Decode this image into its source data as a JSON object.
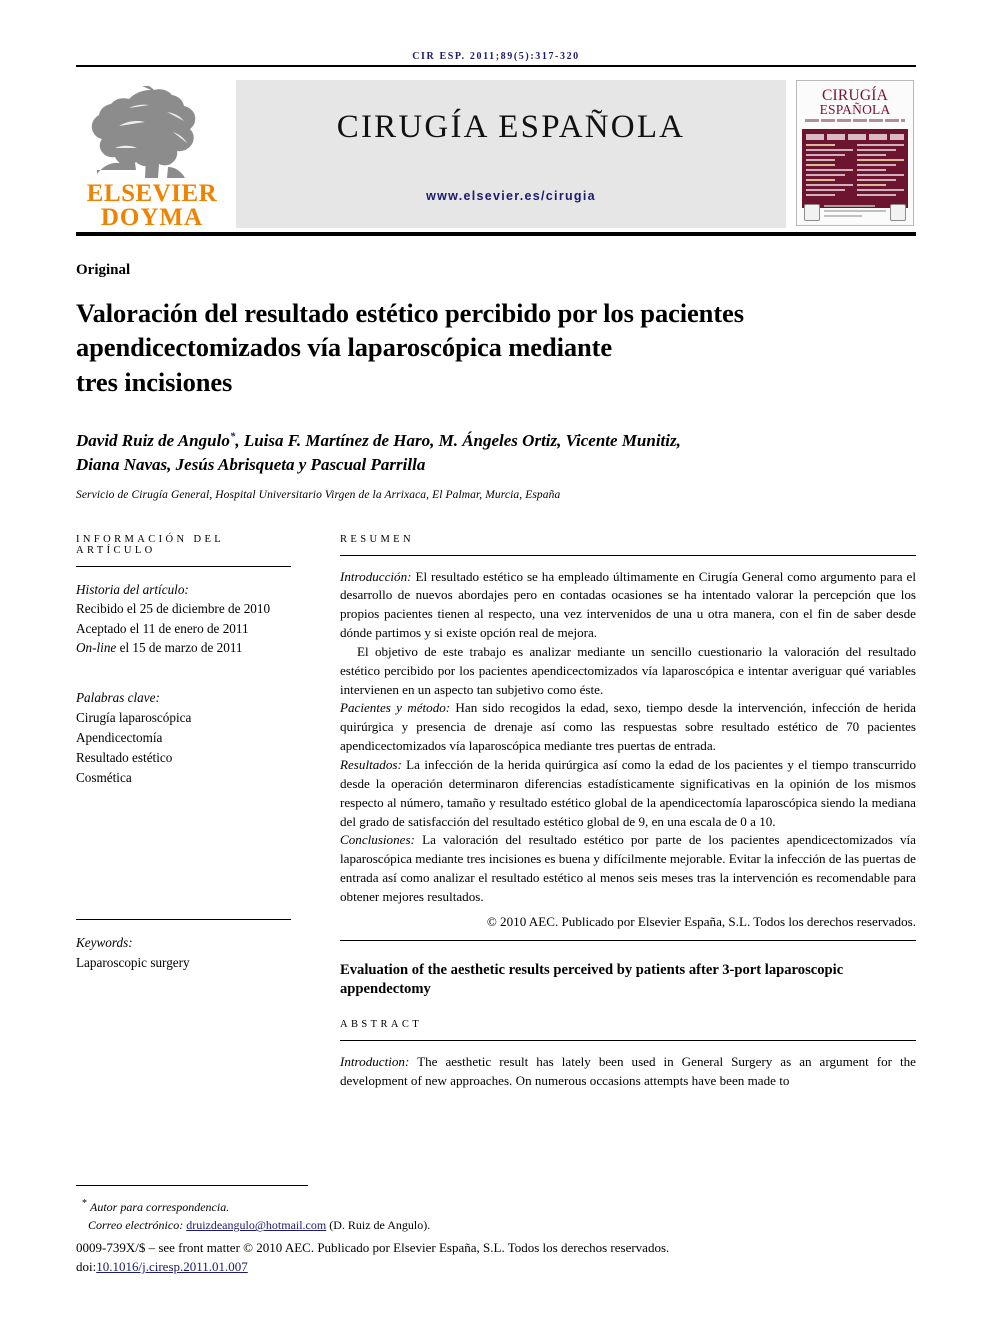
{
  "running_head": "CIR ESP. 2011;89(5):317-320",
  "masthead": {
    "publisher_line1": "ELSEVIER",
    "publisher_line2": "DOYMA",
    "journal_name": "CIRUGÍA ESPAÑOLA",
    "journal_url": "www.elsevier.es/cirugia",
    "cover": {
      "title_line1": "CIRUGÍA",
      "title_line2": "ESPAÑOLA"
    },
    "colors": {
      "elsevier_orange": "#ef8200",
      "masthead_gray": "#e6e6e6",
      "cover_maroon": "#6d1431",
      "link_navy": "#1b1b6f"
    }
  },
  "article": {
    "kicker": "Original",
    "title": "Valoración del resultado estético percibido por los pacientes apendicectomizados vía laparoscópica mediante tres incisiones",
    "title_lines": [
      "Valoración del resultado estético percibido por los pacientes",
      "apendicectomizados vía laparoscópica mediante",
      "tres incisiones"
    ],
    "authors_line1": "David Ruiz de Angulo",
    "author_marker": "*",
    "authors_line1_rest": ", Luisa F. Martínez de Haro, M. Ángeles Ortiz, Vicente Munitiz,",
    "authors_line2": "Diana Navas, Jesús Abrisqueta y Pascual Parrilla",
    "affiliation": "Servicio de Cirugía General, Hospital Universitario Virgen de la Arrixaca, El Palmar, Murcia, España"
  },
  "info": {
    "heading": "INFORMACIÓN DEL ARTÍCULO",
    "history_label": "Historia del artículo:",
    "received": "Recibido el 25 de diciembre de 2010",
    "accepted": "Aceptado el 11 de enero de 2011",
    "online_label": "On-line",
    "online_rest": " el 15 de marzo de 2011",
    "keywords_label": "Palabras clave:",
    "keywords": [
      "Cirugía laparoscópica",
      "Apendicectomía",
      "Resultado estético",
      "Cosmética"
    ],
    "keywords_en_label": "Keywords:",
    "keywords_en": [
      "Laparoscopic surgery"
    ]
  },
  "abstract_es": {
    "heading": "RESUMEN",
    "intro_label": "Introducción:",
    "intro_text": " El resultado estético se ha empleado últimamente en Cirugía General como argumento para el desarrollo de nuevos abordajes pero en contadas ocasiones se ha intentado valorar la percepción que los propios pacientes tienen al respecto, una vez intervenidos de una u otra manera, con el fin de saber desde dónde partimos y si existe opción real de mejora.",
    "objective_text": "El objetivo de este trabajo es analizar mediante un sencillo cuestionario la valoración del resultado estético percibido por los pacientes apendicectomizados vía laparoscópica e intentar averiguar qué variables intervienen en un aspecto tan subjetivo como éste.",
    "methods_label": "Pacientes y método:",
    "methods_text": " Han sido recogidos la edad, sexo, tiempo desde la intervención, infección de herida quirúrgica y presencia de drenaje así como las respuestas sobre resultado estético de 70 pacientes apendicectomizados vía laparoscópica mediante tres puertas de entrada.",
    "results_label": "Resultados:",
    "results_text": " La infección de la herida quirúrgica así como la edad de los pacientes y el tiempo transcurrido desde la operación determinaron diferencias estadísticamente significativas en la opinión de los mismos respecto al número, tamaño y resultado estético global de la apendicectomía laparoscópica siendo la mediana del grado de satisfacción del resultado estético global de 9, en una escala de 0 a 10.",
    "conclusions_label": "Conclusiones:",
    "conclusions_text": " La valoración del resultado estético por parte de los pacientes apendicectomizados vía laparoscópica mediante tres incisiones es buena y difícilmente mejorable. Evitar la infección de las puertas de entrada así como analizar el resultado estético al menos seis meses tras la intervención es recomendable para obtener mejores resultados.",
    "copyright": "© 2010 AEC. Publicado por Elsevier España, S.L. Todos los derechos reservados."
  },
  "abstract_en": {
    "title": "Evaluation of the aesthetic results perceived by patients after 3-port laparoscopic appendectomy",
    "heading": "ABSTRACT",
    "intro_label": "Introduction:",
    "intro_text": "  The aesthetic result has lately been used in General Surgery as an argument for the development of new approaches. On numerous occasions attempts have been made to"
  },
  "footer": {
    "corresponding_marker": "*",
    "corresponding_label": "Autor para correspondencia.",
    "email_label": "Correo electrónico:",
    "email": "druizdeangulo@hotmail.com",
    "email_owner": "(D. Ruiz de Angulo).",
    "issn_line": "0009-739X/$ – see front matter © 2010 AEC. Publicado por Elsevier España, S.L. Todos los derechos reservados.",
    "doi_label": "doi:",
    "doi": "10.1016/j.ciresp.2011.01.007"
  }
}
